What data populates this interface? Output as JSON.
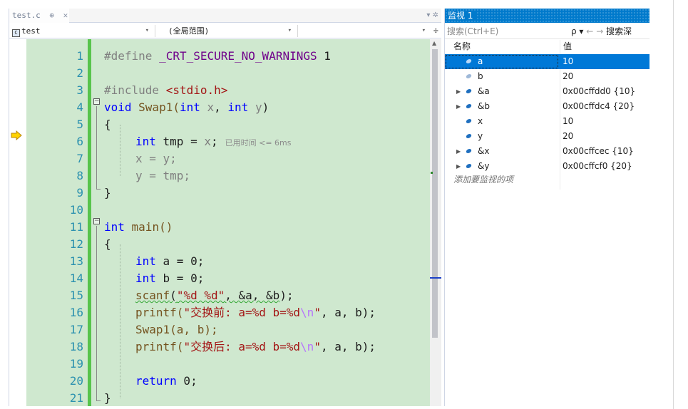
{
  "tab": {
    "filename": "test.c",
    "pin": "⊕",
    "close": "✕",
    "tools": "▾ ✲"
  },
  "nav": {
    "project": "test",
    "scope": "(全局范围)",
    "dropdown": "▾",
    "split": "÷"
  },
  "code_lines": [
    {
      "n": "1"
    },
    {
      "n": "2"
    },
    {
      "n": "3"
    },
    {
      "n": "4"
    },
    {
      "n": "5"
    },
    {
      "n": "6"
    },
    {
      "n": "7"
    },
    {
      "n": "8"
    },
    {
      "n": "9"
    },
    {
      "n": "10"
    },
    {
      "n": "11"
    },
    {
      "n": "12"
    },
    {
      "n": "13"
    },
    {
      "n": "14"
    },
    {
      "n": "15"
    },
    {
      "n": "16"
    },
    {
      "n": "17"
    },
    {
      "n": "18"
    },
    {
      "n": "19"
    },
    {
      "n": "20"
    },
    {
      "n": "21"
    }
  ],
  "code": {
    "l1_pre": "#define ",
    "l1_macro": "_CRT_SECURE_NO_WARNINGS",
    "l1_val": " 1",
    "l3_pre": "#include ",
    "l3_hdr": "<stdio.h>",
    "l4_kw": "void",
    "l4_name": " Swap1(",
    "l4_kw2": "int",
    "l4_p1": " x",
    "l4_sep": ", ",
    "l4_kw3": "int",
    "l4_p2": " y",
    "l4_end": ")",
    "brace_open": "{",
    "brace_close": "}",
    "l6_kw": "int",
    "l6_rest": " tmp = ",
    "l6_x": "x",
    "l6_end": ";",
    "l6_hint": "已用时间 <= 6ms",
    "l7": "x = y;",
    "l8": "y = tmp;",
    "l11_kw": "int",
    "l11_rest": " main()",
    "l13_kw": "int",
    "l13_rest": " a = 0;",
    "l14_kw": "int",
    "l14_rest": " b = 0;",
    "l15_fn": "scanf",
    "l15_o": "(",
    "l15_s": "\"%d %d\"",
    "l15_rest": ", &a, &b",
    "l15_e": ");",
    "l16_fn": "printf(",
    "l16_s1": "\"交换前: a=%d b=%d",
    "l16_esc": "\\n",
    "l16_s2": "\"",
    "l16_rest": ", a, b);",
    "l17": "Swap1(a, b);",
    "l18_fn": "printf(",
    "l18_s1": "\"交换后: a=%d b=%d",
    "l18_esc": "\\n",
    "l18_s2": "\"",
    "l18_rest": ", a, b);",
    "l20_kw": "return",
    "l20_rest": " 0;"
  },
  "watch": {
    "title": "监视 1",
    "search_placeholder": "搜索(Ctrl+E)",
    "search_icon": "⌕",
    "search_tools": "ρ ▾",
    "nav_back": "←",
    "nav_fwd": "→",
    "search_depth": "搜索深",
    "col_name": "名称",
    "col_value": "值",
    "rows": [
      {
        "name": "a",
        "value": "10",
        "expandable": false
      },
      {
        "name": "b",
        "value": "20",
        "expandable": false
      },
      {
        "name": "&a",
        "value": "0x00cffdd0 {10}",
        "expandable": true
      },
      {
        "name": "&b",
        "value": "0x00cffdc4 {20}",
        "expandable": true
      },
      {
        "name": "x",
        "value": "10",
        "expandable": false
      },
      {
        "name": "y",
        "value": "20",
        "expandable": false
      },
      {
        "name": "&x",
        "value": "0x00cffcec {10}",
        "expandable": true
      },
      {
        "name": "&y",
        "value": "0x00cffcf0 {20}",
        "expandable": true
      }
    ],
    "add_item": "添加要监视的项"
  },
  "colors": {
    "accent": "#007acc",
    "selection": "#0078d7",
    "editor_bg": "#cfe8cf",
    "changebar": "#57c44c"
  }
}
